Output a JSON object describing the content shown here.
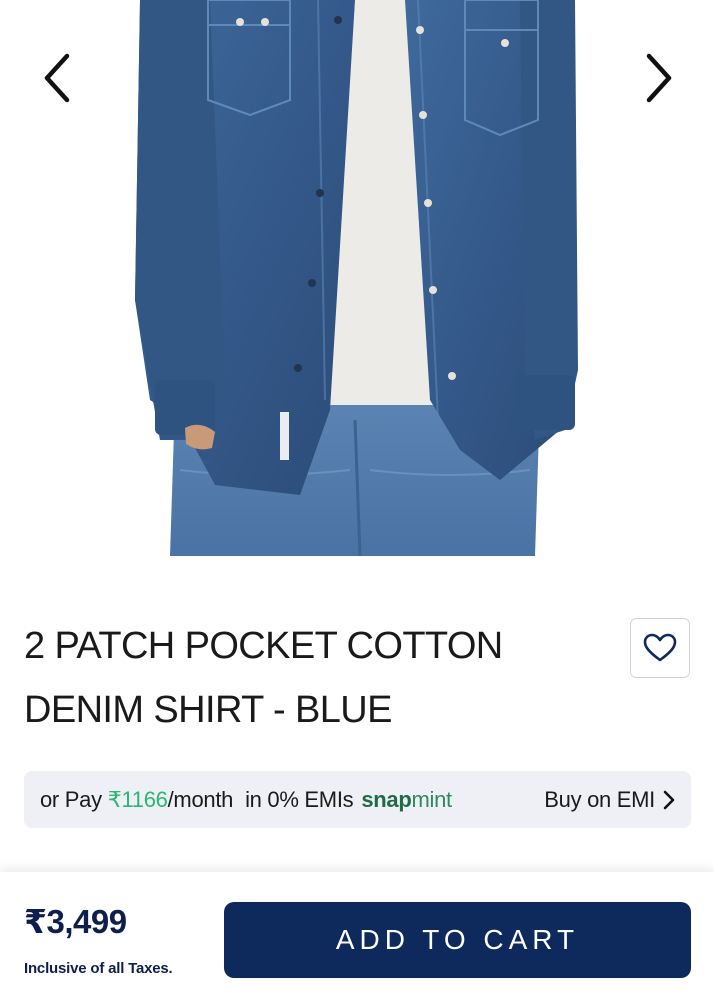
{
  "product": {
    "title_line1": "2 PATCH POCKET COTTON",
    "title_line2": "DENIM SHIRT - BLUE",
    "image_icon": "denim-shirt-photo"
  },
  "carousel": {
    "prev_icon": "chevron-left-icon",
    "next_icon": "chevron-right-icon"
  },
  "wishlist": {
    "icon": "heart-icon"
  },
  "emi": {
    "prefix": "or Pay",
    "amount": "₹1166",
    "per": "/month",
    "in_text": "in 0% EMIs",
    "brand_bold": "snap",
    "brand_light": "mint",
    "buy_label": "Buy on EMI",
    "buy_icon": "chevron-right-icon"
  },
  "bottom_bar": {
    "price": "₹3,499",
    "tax_note": "Inclusive of all Taxes.",
    "cta_label": "ADD TO CART"
  },
  "colors": {
    "cta_bg": "#0e2a5c",
    "price": "#0f1f4d",
    "emi_amount": "#2bb673",
    "emi_brand": "#1f6b49",
    "emi_bg": "#eef0f5"
  }
}
